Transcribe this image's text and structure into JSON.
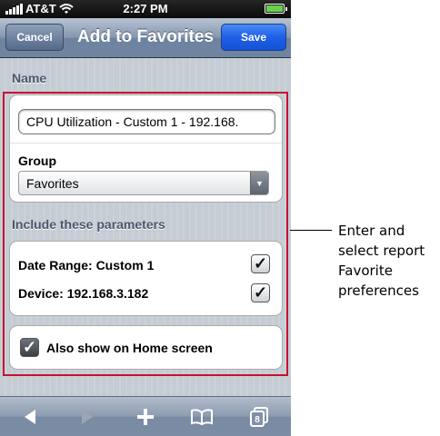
{
  "status_bar": {
    "carrier": "AT&T",
    "time": "2:27 PM"
  },
  "nav": {
    "cancel_label": "Cancel",
    "title": "Add to Favorites",
    "save_label": "Save"
  },
  "name_section": {
    "label": "Name",
    "value": "CPU Utilization - Custom 1 - 192.168."
  },
  "group": {
    "label": "Group",
    "selected": "Favorites"
  },
  "parameters": {
    "label": "Include these parameters",
    "items": [
      {
        "label": "Date Range: Custom 1",
        "checked": true
      },
      {
        "label": "Device: 192.168.3.182",
        "checked": true
      }
    ]
  },
  "home_screen": {
    "label": "Also show on Home screen",
    "checked": true
  },
  "toolbar": {
    "tabs_count": "8"
  },
  "annotation": {
    "text": "Enter and select report Favorite preferences"
  },
  "colors": {
    "highlight": "#c8102e",
    "save_button": "#1e5fe6",
    "nav_bar": "#6e83a0"
  }
}
